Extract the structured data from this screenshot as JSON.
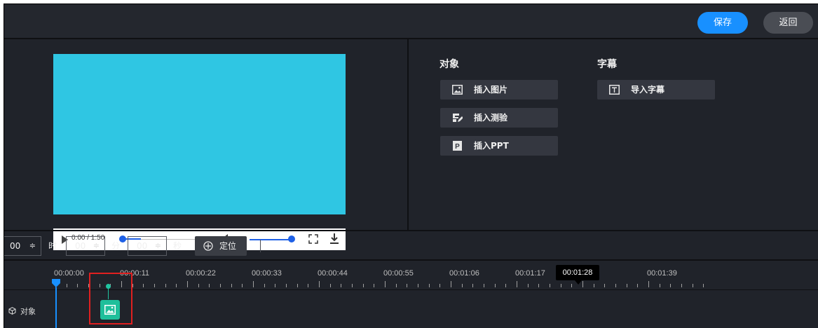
{
  "toolbar": {
    "save_label": "保存",
    "back_label": "返回"
  },
  "player": {
    "time": "0:00 / 1:50",
    "progress": 0.0,
    "volume": 1.0,
    "video_color": "#2fc6e3"
  },
  "objects_panel": {
    "title": "对象",
    "items": [
      {
        "label": "插入图片",
        "icon": "image-icon"
      },
      {
        "label": "插入测验",
        "icon": "quiz-edit-icon"
      },
      {
        "label": "插入PPT",
        "icon": "ppt-icon"
      }
    ]
  },
  "subtitle_panel": {
    "title": "字幕",
    "items": [
      {
        "label": "导入字幕",
        "icon": "text-icon"
      }
    ]
  },
  "locate": {
    "hours": "00",
    "hours_unit": "时",
    "minutes": "00",
    "minutes_unit": "分",
    "seconds": "00",
    "seconds_unit": "秒",
    "spinner": "≑",
    "button_label": "定位"
  },
  "timeline": {
    "ticks": [
      "00:00:00",
      "00:00:11",
      "00:00:22",
      "00:00:33",
      "00:00:44",
      "00:00:55",
      "00:01:06",
      "00:01:17",
      "00:01:28",
      "00:01:39"
    ],
    "hover_time": "00:01:28",
    "track_label": "对象"
  },
  "colors": {
    "accent": "#1890ff",
    "clip": "#1fbf9b",
    "highlight": "#e02020"
  }
}
